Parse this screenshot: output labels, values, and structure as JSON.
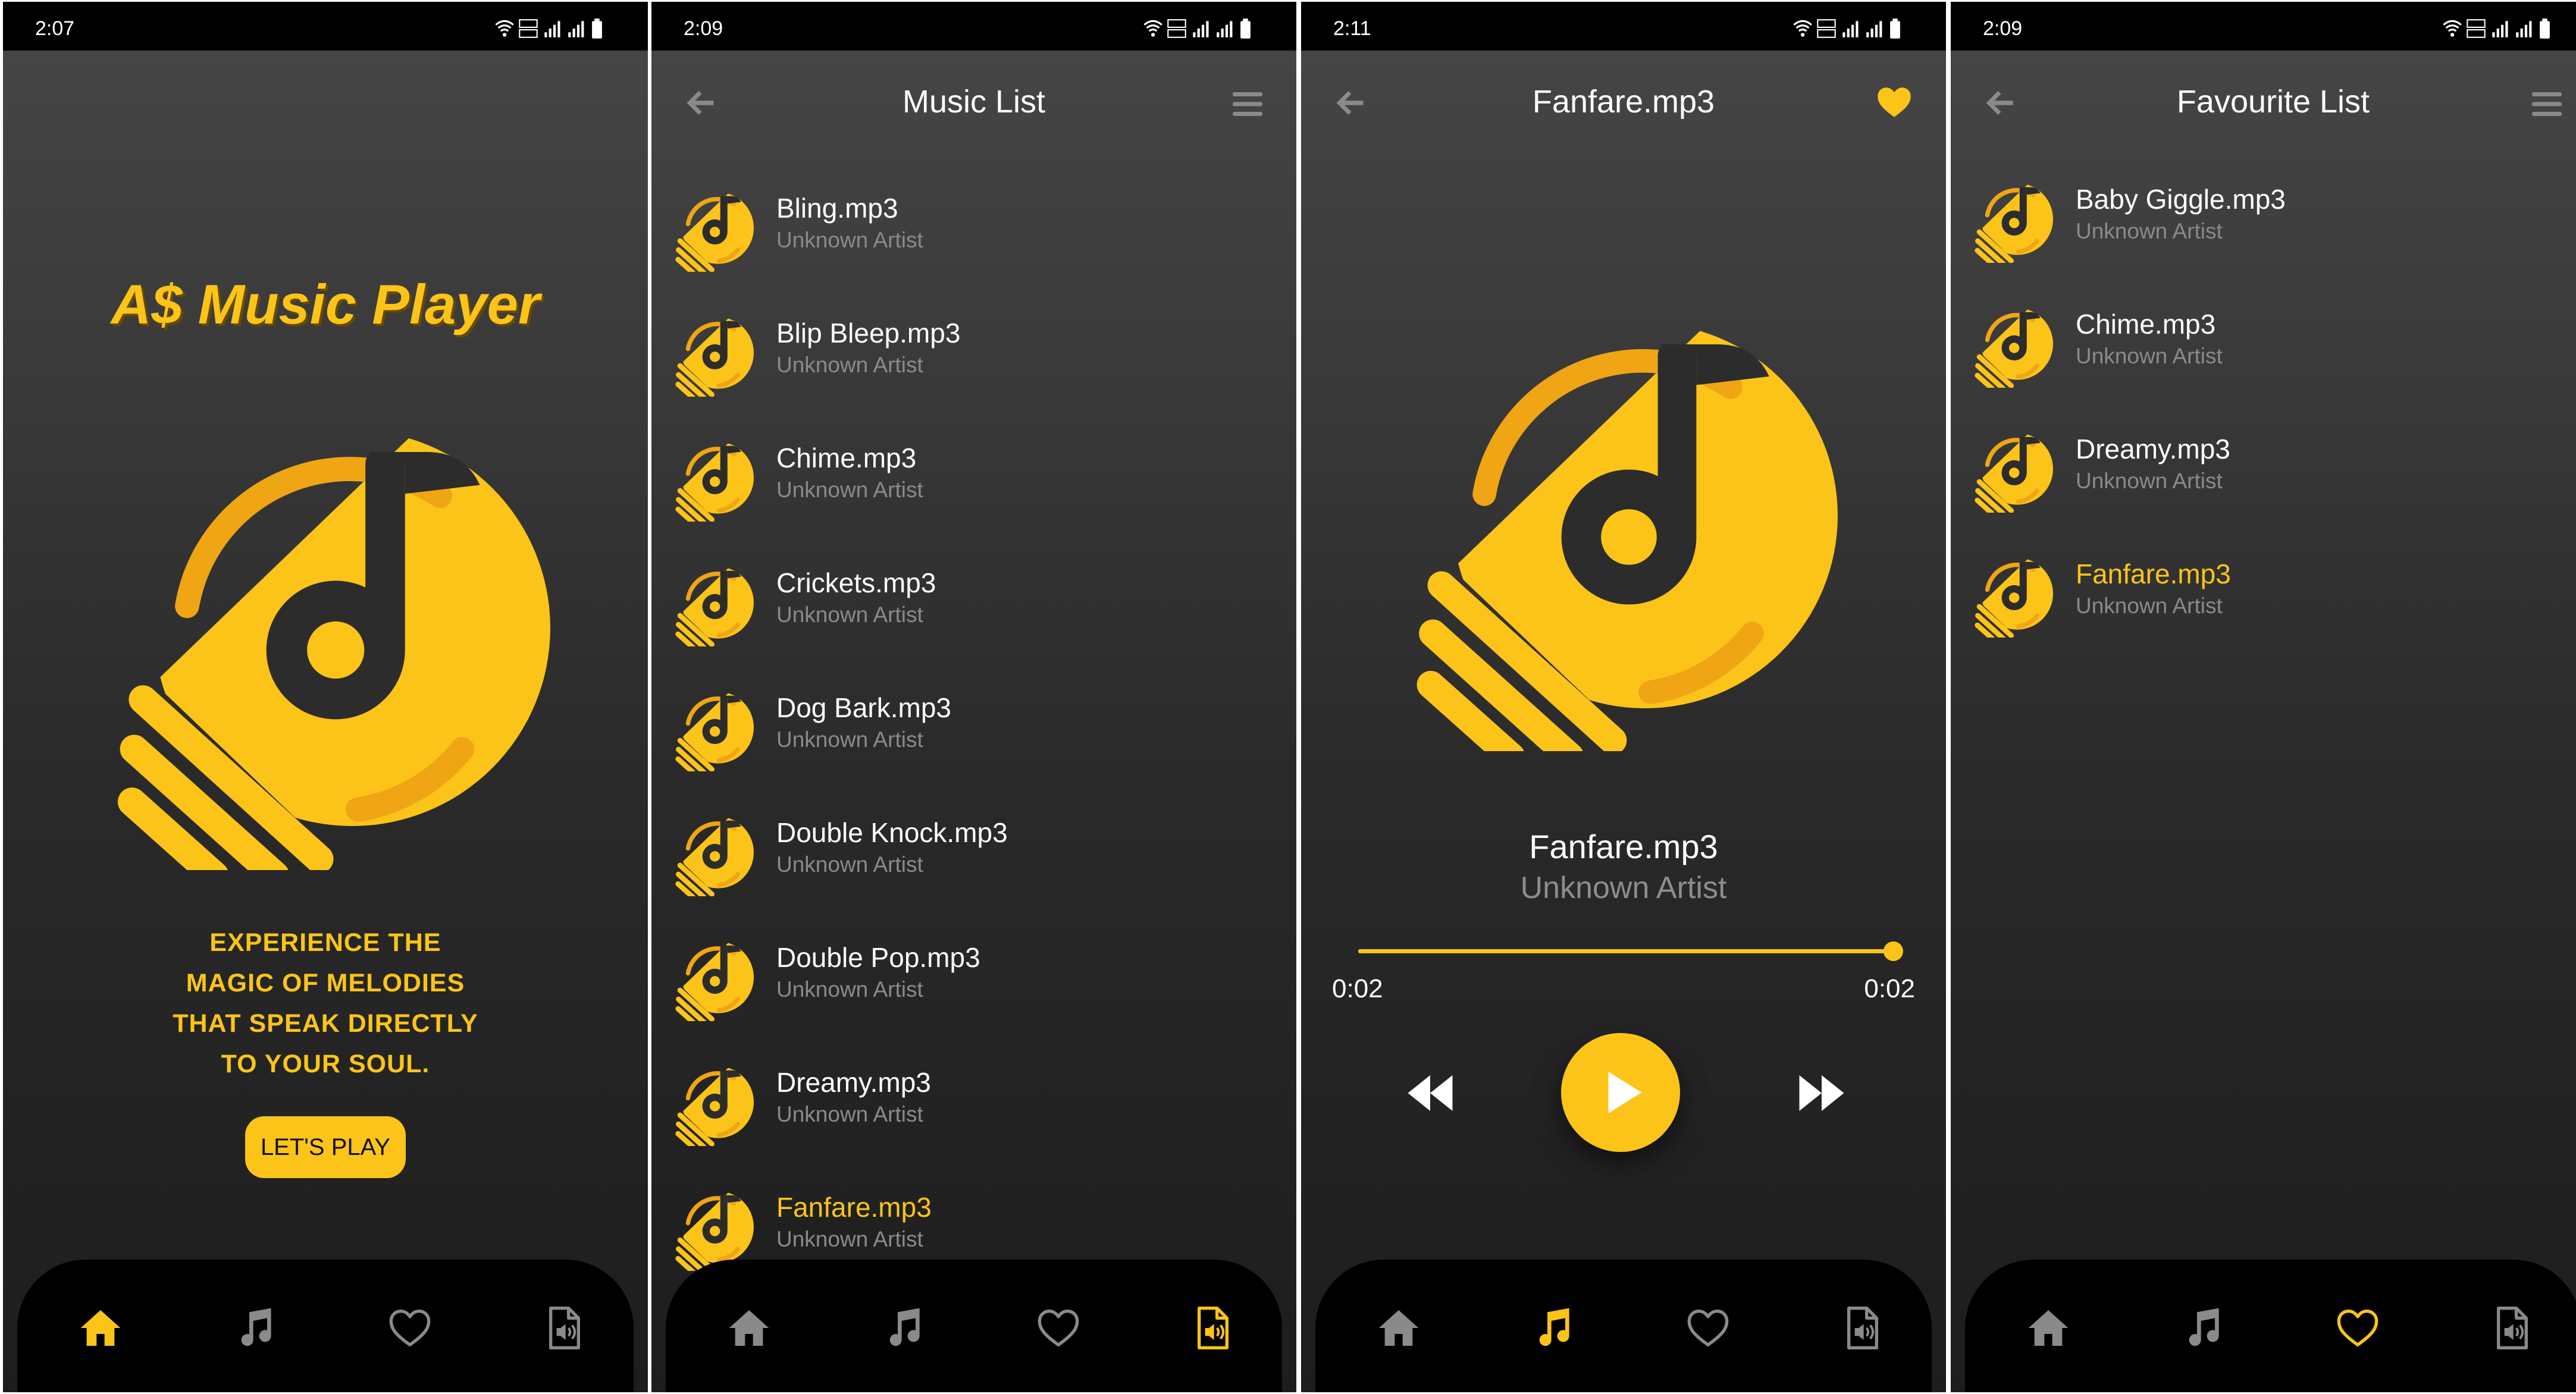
{
  "colors": {
    "accent": "#fcc419",
    "background_top": "#474747",
    "background_bottom": "#1d1d1d",
    "muted_text": "#8a8a8a",
    "nav_bar": "#000000"
  },
  "screens": [
    {
      "id": "home",
      "status_time": "2:07",
      "app_title": "A$ Music Player",
      "tagline": [
        "EXPERIENCE THE",
        "MAGIC OF MELODIES",
        "THAT SPEAK DIRECTLY",
        "TO YOUR SOUL."
      ],
      "cta_label": "LET'S PLAY",
      "active_tab": "home"
    },
    {
      "id": "music-list",
      "status_time": "2:09",
      "title": "Music List",
      "active_tab": "files",
      "songs": [
        {
          "name": "Bling.mp3",
          "artist": "Unknown Artist"
        },
        {
          "name": "Blip Bleep.mp3",
          "artist": "Unknown Artist"
        },
        {
          "name": "Chime.mp3",
          "artist": "Unknown Artist"
        },
        {
          "name": "Crickets.mp3",
          "artist": "Unknown Artist"
        },
        {
          "name": "Dog Bark.mp3",
          "artist": "Unknown Artist"
        },
        {
          "name": "Double Knock.mp3",
          "artist": "Unknown Artist"
        },
        {
          "name": "Double Pop.mp3",
          "artist": "Unknown Artist"
        },
        {
          "name": "Dreamy.mp3",
          "artist": "Unknown Artist"
        },
        {
          "name": "Fanfare.mp3",
          "artist": "Unknown Artist"
        }
      ],
      "highlighted_song": "Fanfare.mp3"
    },
    {
      "id": "now-playing",
      "status_time": "2:11",
      "title": "Fanfare.mp3",
      "track_title": "Fanfare.mp3",
      "track_artist": "Unknown Artist",
      "time_elapsed": "0:02",
      "time_total": "0:02",
      "progress": 1.0,
      "is_favourite": true,
      "active_tab": "music"
    },
    {
      "id": "favourite-list",
      "status_time": "2:09",
      "title": "Favourite List",
      "active_tab": "favourites",
      "songs": [
        {
          "name": "Baby Giggle.mp3",
          "artist": "Unknown Artist"
        },
        {
          "name": "Chime.mp3",
          "artist": "Unknown Artist"
        },
        {
          "name": "Dreamy.mp3",
          "artist": "Unknown Artist"
        },
        {
          "name": "Fanfare.mp3",
          "artist": "Unknown Artist"
        }
      ],
      "highlighted_song": "Fanfare.mp3"
    }
  ],
  "icons": {
    "nav": [
      "home-icon",
      "music-note-icon",
      "heart-icon",
      "audio-file-icon"
    ],
    "topbar": [
      "back-arrow-icon",
      "menu-icon",
      "heart-filled-icon"
    ],
    "player": [
      "rewind-icon",
      "play-icon",
      "fast-forward-icon"
    ],
    "song": "disc-note-icon"
  }
}
